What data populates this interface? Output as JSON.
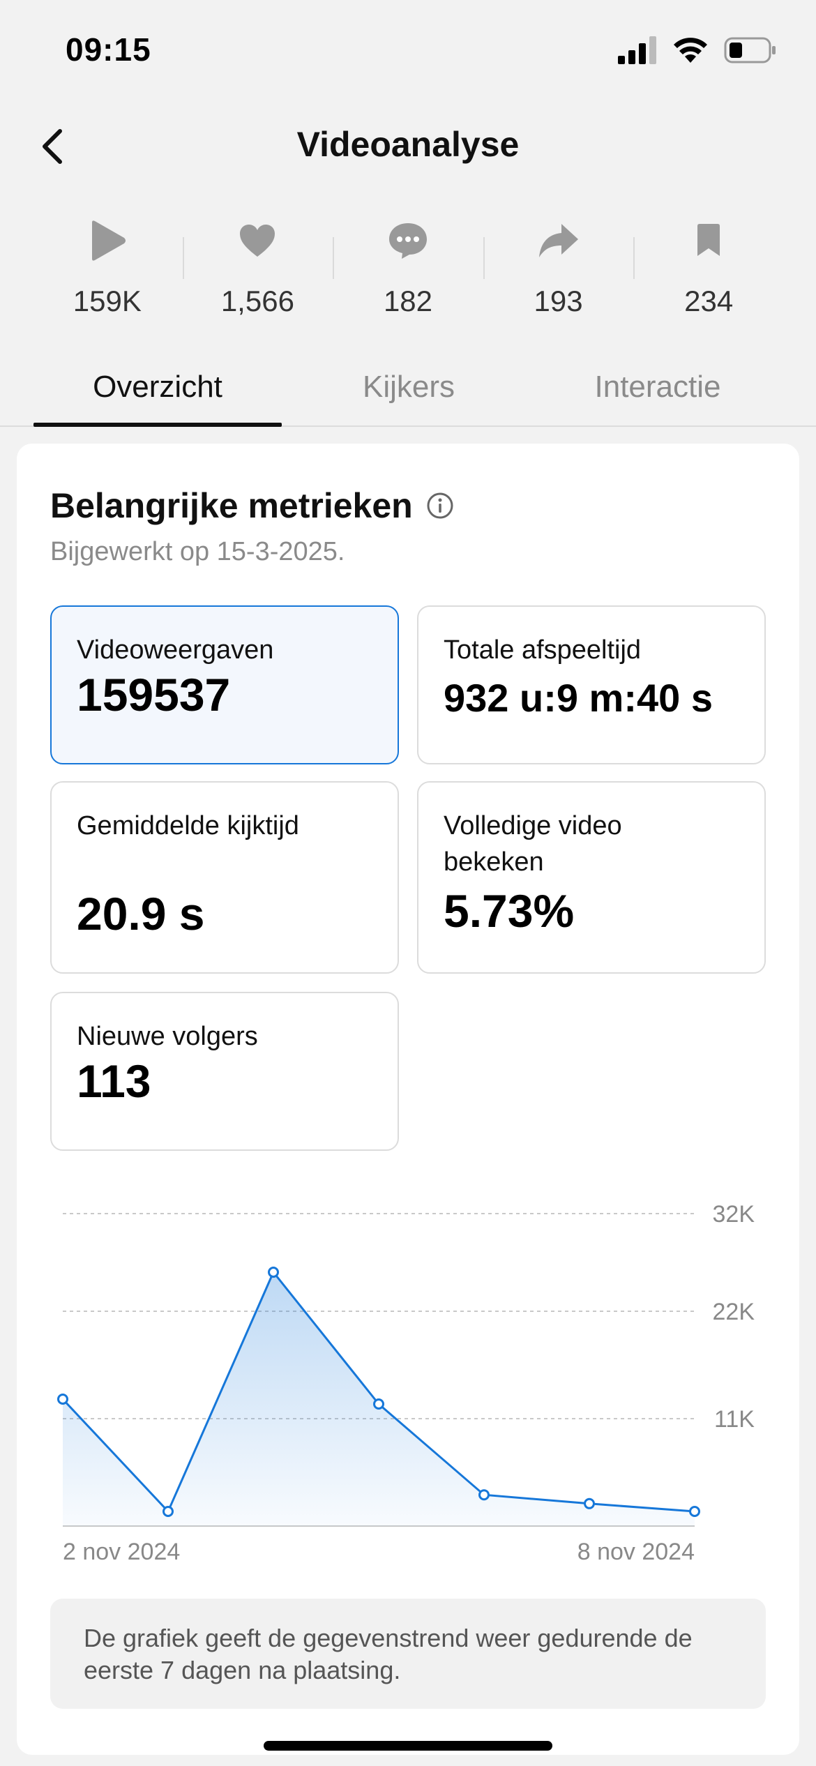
{
  "status_bar": {
    "time": "09:15"
  },
  "header": {
    "title": "Videoanalyse"
  },
  "stats": [
    {
      "icon": "play-icon",
      "value": "159K"
    },
    {
      "icon": "heart-icon",
      "value": "1,566"
    },
    {
      "icon": "comment-icon",
      "value": "182"
    },
    {
      "icon": "share-icon",
      "value": "193"
    },
    {
      "icon": "bookmark-icon",
      "value": "234"
    }
  ],
  "tabs": [
    {
      "label": "Overzicht",
      "active": true
    },
    {
      "label": "Kijkers",
      "active": false
    },
    {
      "label": "Interactie",
      "active": false
    }
  ],
  "section": {
    "title": "Belangrijke metrieken",
    "updated": "Bijgewerkt op 15-3-2025."
  },
  "metrics": [
    {
      "label": "Videoweergaven",
      "value": "159537",
      "selected": true
    },
    {
      "label": "Totale afspeeltijd",
      "value": "932 u:9 m:40 s",
      "selected": false
    },
    {
      "label": "Gemiddelde kijktijd",
      "value": "20.9 s",
      "selected": false
    },
    {
      "label": "Volledige video bekeken",
      "value": "5.73%",
      "selected": false
    },
    {
      "label": "Nieuwe volgers",
      "value": "113",
      "selected": false
    }
  ],
  "chart_data": {
    "type": "area",
    "x": [
      "2 nov 2024",
      "3 nov 2024",
      "4 nov 2024",
      "5 nov 2024",
      "6 nov 2024",
      "7 nov 2024",
      "8 nov 2024"
    ],
    "x_tick_labels": [
      "2 nov 2024",
      "8 nov 2024"
    ],
    "series": [
      {
        "values": [
          13000,
          1500,
          26000,
          12500,
          3200,
          2300,
          1500
        ]
      }
    ],
    "y_ticks": [
      "11K",
      "22K",
      "32K"
    ],
    "ylim": [
      0,
      33000
    ],
    "grid": true,
    "color": "#1677d9"
  },
  "note": "De grafiek geeft de gegevenstrend weer gedurende de eerste 7 dagen na plaatsing."
}
